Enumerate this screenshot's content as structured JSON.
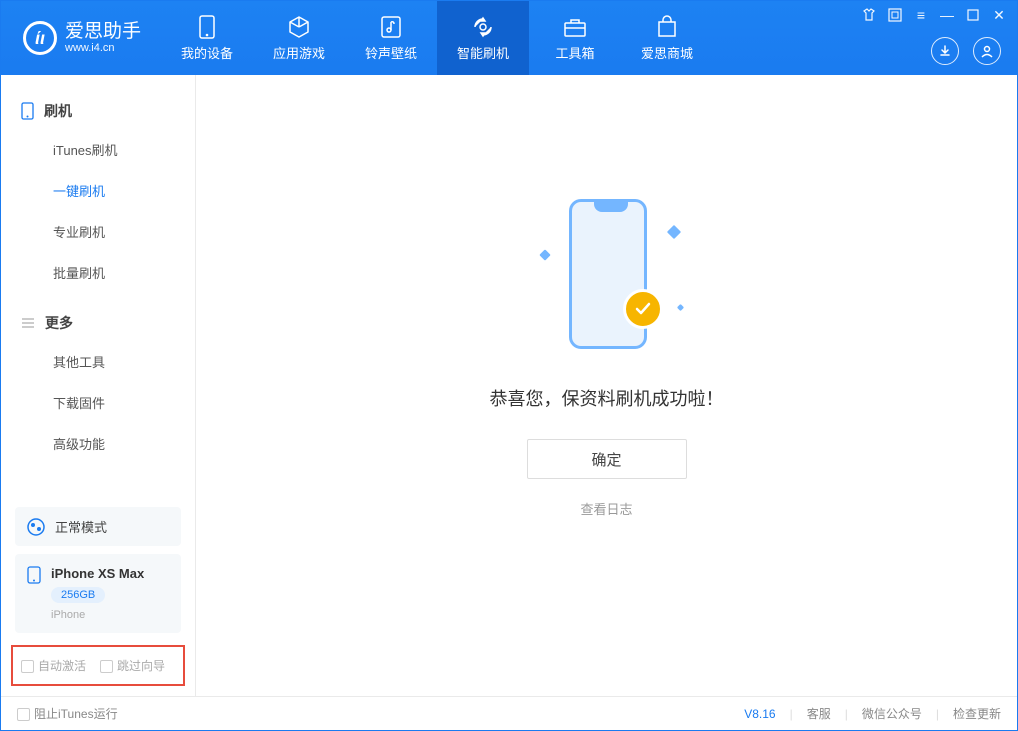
{
  "app": {
    "name_cn": "爱思助手",
    "name_en": "www.i4.cn"
  },
  "nav": {
    "items": [
      {
        "label": "我的设备",
        "icon": "device-icon"
      },
      {
        "label": "应用游戏",
        "icon": "cube-icon"
      },
      {
        "label": "铃声壁纸",
        "icon": "music-icon"
      },
      {
        "label": "智能刷机",
        "icon": "refresh-icon"
      },
      {
        "label": "工具箱",
        "icon": "toolbox-icon"
      },
      {
        "label": "爱思商城",
        "icon": "bag-icon"
      }
    ]
  },
  "sidebar": {
    "group1": {
      "title": "刷机"
    },
    "items1": [
      {
        "label": "iTunes刷机"
      },
      {
        "label": "一键刷机"
      },
      {
        "label": "专业刷机"
      },
      {
        "label": "批量刷机"
      }
    ],
    "group2": {
      "title": "更多"
    },
    "items2": [
      {
        "label": "其他工具"
      },
      {
        "label": "下载固件"
      },
      {
        "label": "高级功能"
      }
    ],
    "mode_label": "正常模式",
    "device": {
      "name": "iPhone XS Max",
      "storage": "256GB",
      "type": "iPhone"
    },
    "opt1": "自动激活",
    "opt2": "跳过向导"
  },
  "main": {
    "success_title": "恭喜您，保资料刷机成功啦！",
    "confirm_label": "确定",
    "view_log": "查看日志"
  },
  "footer": {
    "stop_itunes": "阻止iTunes运行",
    "version": "V8.16",
    "link1": "客服",
    "link2": "微信公众号",
    "link3": "检查更新"
  }
}
